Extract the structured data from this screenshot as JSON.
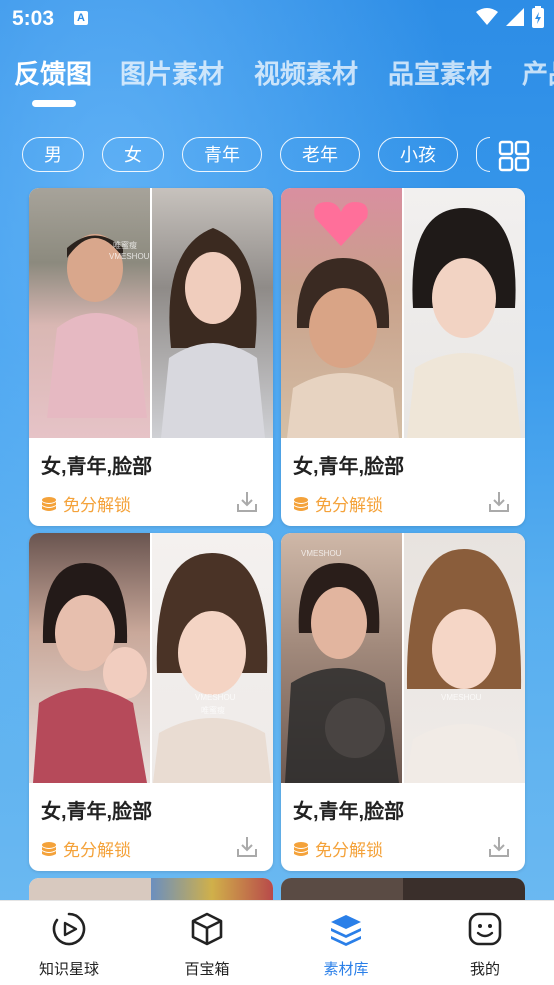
{
  "status_bar": {
    "time": "5:03",
    "notif_icon": "A"
  },
  "tabs": [
    {
      "label": "反馈图",
      "active": true
    },
    {
      "label": "图片素材",
      "active": false
    },
    {
      "label": "视频素材",
      "active": false
    },
    {
      "label": "品宣素材",
      "active": false
    },
    {
      "label": "产品",
      "active": false
    }
  ],
  "chips": [
    "男",
    "女",
    "青年",
    "老年",
    "小孩"
  ],
  "cards": [
    {
      "title": "女,青年,脸部",
      "unlock": "免分解锁"
    },
    {
      "title": "女,青年,脸部",
      "unlock": "免分解锁"
    },
    {
      "title": "女,青年,脸部",
      "unlock": "免分解锁"
    },
    {
      "title": "女,青年,脸部",
      "unlock": "免分解锁"
    }
  ],
  "watermark": {
    "brand": "VMESHOU",
    "cn": "唯蜜瘦"
  },
  "nav": [
    {
      "label": "知识星球",
      "icon": "play-circle-icon",
      "active": false
    },
    {
      "label": "百宝箱",
      "icon": "box-icon",
      "active": false
    },
    {
      "label": "素材库",
      "icon": "layers-icon",
      "active": true
    },
    {
      "label": "我的",
      "icon": "smiley-icon",
      "active": false
    }
  ],
  "colors": {
    "accent": "#2a7fe8",
    "unlock": "#f4a23a",
    "background": "#2f8fe4"
  }
}
